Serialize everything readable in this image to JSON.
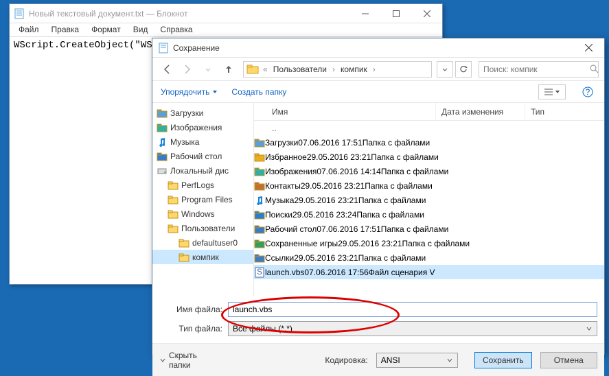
{
  "notepad": {
    "title": "Новый текстовый документ.txt — Блокнот",
    "menu": [
      "Файл",
      "Правка",
      "Формат",
      "Вид",
      "Справка"
    ],
    "content": "WScript.CreateObject(\"WS"
  },
  "savedlg": {
    "title": "Сохранение",
    "breadcrumb": {
      "root": "Пользователи",
      "folder": "компик"
    },
    "search_placeholder": "Поиск: компик",
    "toolbar": {
      "organize": "Упорядочить",
      "newfolder": "Создать папку"
    },
    "tree": [
      {
        "label": "Загрузки",
        "icon": "downloads",
        "ind": 0
      },
      {
        "label": "Изображения",
        "icon": "pictures",
        "ind": 0
      },
      {
        "label": "Музыка",
        "icon": "music",
        "ind": 0
      },
      {
        "label": "Рабочий стол",
        "icon": "desktop",
        "ind": 0
      },
      {
        "label": "Локальный дис",
        "icon": "disk",
        "ind": 0
      },
      {
        "label": "PerfLogs",
        "icon": "folder",
        "ind": 1
      },
      {
        "label": "Program Files",
        "icon": "folder",
        "ind": 1
      },
      {
        "label": "Windows",
        "icon": "folder",
        "ind": 1
      },
      {
        "label": "Пользователи",
        "icon": "folder",
        "ind": 1
      },
      {
        "label": "defaultuser0",
        "icon": "folder",
        "ind": 2
      },
      {
        "label": "компик",
        "icon": "folder",
        "ind": 2,
        "sel": true
      }
    ],
    "columns": {
      "name": "Имя",
      "date": "Дата изменения",
      "type": "Тип"
    },
    "files": [
      {
        "name": "Загрузки",
        "icon": "downloads",
        "date": "07.06.2016 17:51",
        "type": "Папка с файлами"
      },
      {
        "name": "Избранное",
        "icon": "favorites",
        "date": "29.05.2016 23:21",
        "type": "Папка с файлами"
      },
      {
        "name": "Изображения",
        "icon": "pictures",
        "date": "07.06.2016 14:14",
        "type": "Папка с файлами"
      },
      {
        "name": "Контакты",
        "icon": "contacts",
        "date": "29.05.2016 23:21",
        "type": "Папка с файлами"
      },
      {
        "name": "Музыка",
        "icon": "music",
        "date": "29.05.2016 23:21",
        "type": "Папка с файлами"
      },
      {
        "name": "Поиски",
        "icon": "search",
        "date": "29.05.2016 23:24",
        "type": "Папка с файлами"
      },
      {
        "name": "Рабочий стол",
        "icon": "desktop",
        "date": "07.06.2016 17:51",
        "type": "Папка с файлами"
      },
      {
        "name": "Сохраненные игры",
        "icon": "games",
        "date": "29.05.2016 23:21",
        "type": "Папка с файлами"
      },
      {
        "name": "Ссылки",
        "icon": "links",
        "date": "29.05.2016 23:21",
        "type": "Папка с файлами"
      },
      {
        "name": "launch.vbs",
        "icon": "vbs",
        "date": "07.06.2016 17:56",
        "type": "Файл сценария V",
        "sel": true
      }
    ],
    "up_marker": "..",
    "filename_label": "Имя файла:",
    "filename_value": "launch.vbs",
    "filetype_label": "Тип файла:",
    "filetype_value": "Все файлы  (*.*)",
    "hide_folders": "Скрыть папки",
    "encoding_label": "Кодировка:",
    "encoding_value": "ANSI",
    "save_btn": "Сохранить",
    "cancel_btn": "Отмена"
  }
}
